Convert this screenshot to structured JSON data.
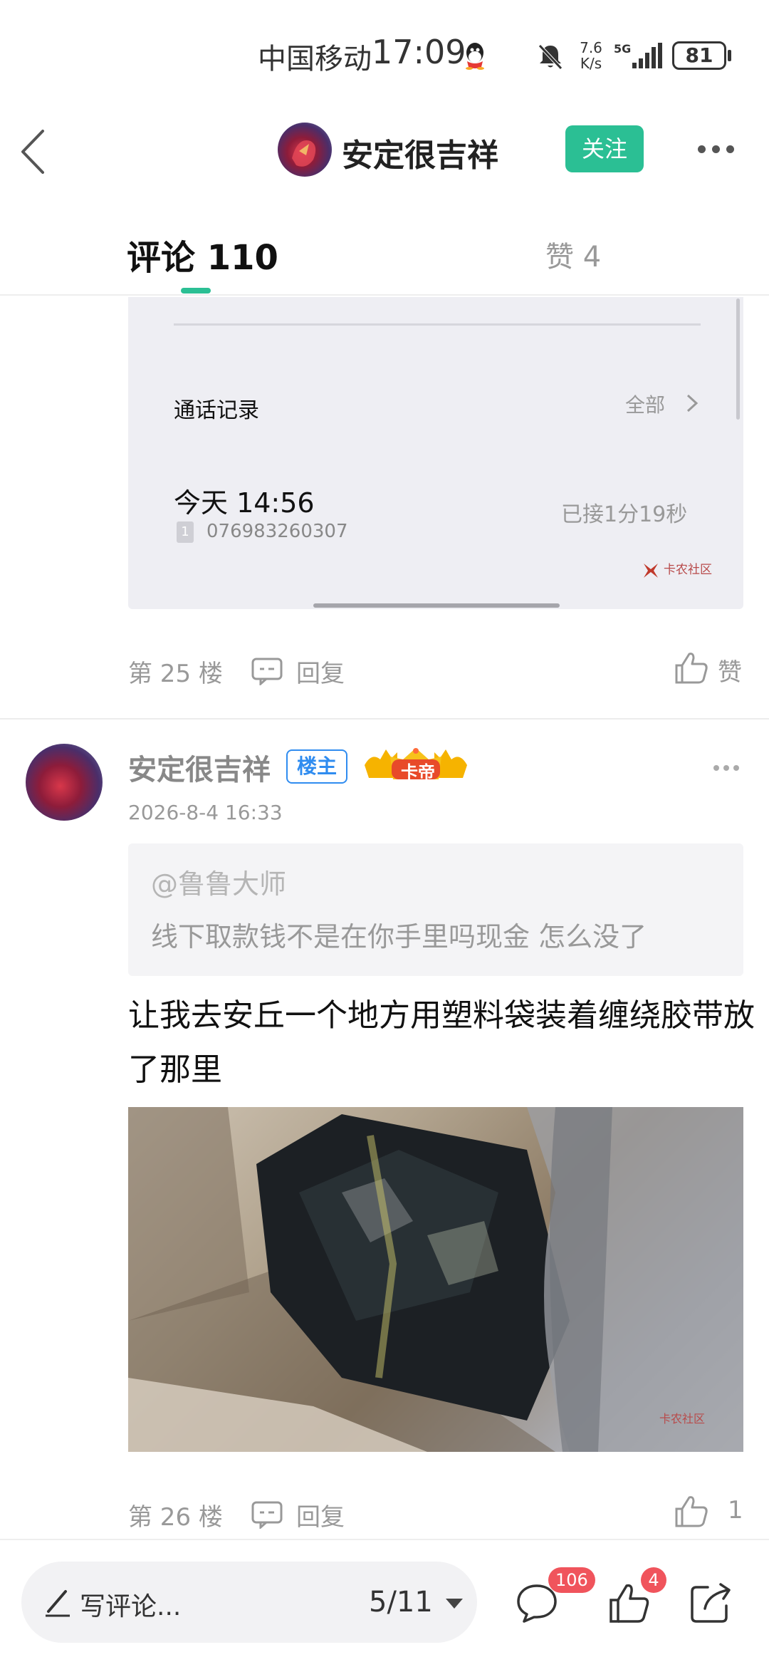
{
  "status_bar": {
    "carrier": "中国移动",
    "time": "17:09",
    "net_speed_value": "7.6",
    "net_speed_unit": "K/s",
    "network": "5G",
    "battery": "81"
  },
  "header": {
    "user_name": "安定很吉祥",
    "follow_label": "关注"
  },
  "tabs": {
    "comments_label": "评论 110",
    "likes_label": "赞 4",
    "accent_color": "#2bbf94"
  },
  "embedded_screenshot": {
    "section_title": "通话记录",
    "all_label": "全部",
    "call_time": "今天 14:56",
    "sim_label": "1",
    "phone_number": "076983260307",
    "call_status": "已接1分19秒",
    "watermark": "卡农社区"
  },
  "floor_25": {
    "floor_label": "第 25 楼",
    "reply_label": "回复",
    "like_label": "赞"
  },
  "comment": {
    "author": "安定很吉祥",
    "owner_badge": "楼主",
    "rank_badge": "卡帝",
    "date": "2026-8-4 16:33",
    "quote_mention": "@鲁鲁大师",
    "quote_text": "线下取款钱不是在你手里吗现金 怎么没了",
    "body": "让我去安丘一个地方用塑料袋装着缠绕胶带放了那里",
    "photo_watermark": "卡农社区",
    "floor_label": "第 26 楼",
    "reply_label": "回复",
    "like_count": "1"
  },
  "bottom_bar": {
    "write_placeholder": "写评论...",
    "page_indicator": "5/11",
    "comment_badge": "106",
    "like_badge": "4"
  }
}
